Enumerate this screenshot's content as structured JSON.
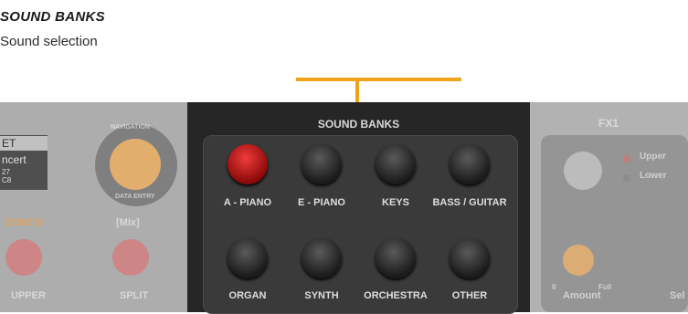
{
  "callout": {
    "title": "SOUND BANKS",
    "subtitle": "Sound selection"
  },
  "sound_banks": {
    "title": "SOUND BANKS",
    "buttons": [
      {
        "label": "A - PIANO",
        "active": true
      },
      {
        "label": "E - PIANO",
        "active": false
      },
      {
        "label": "KEYS",
        "active": false
      },
      {
        "label": "BASS / GUITAR",
        "active": false
      },
      {
        "label": "ORGAN",
        "active": false
      },
      {
        "label": "SYNTH",
        "active": false
      },
      {
        "label": "ORCHESTRA",
        "active": false
      },
      {
        "label": "OTHER",
        "active": false
      }
    ]
  },
  "left_panel": {
    "display_line1": "ET",
    "display_line2": "ncert",
    "display_small1": "27",
    "display_small2": "C8",
    "navigation_label": "NAVIGATION",
    "data_entry_label": "DATA ENTRY",
    "zone_label": "ZONE B",
    "mix_label": "[Mix]",
    "upper_label": "UPPER",
    "split_label": "SPLIT"
  },
  "right_panel": {
    "title": "FX1",
    "upper_label": "Upper",
    "lower_label": "Lower",
    "amount_label": "Amount",
    "amount_min": "0",
    "amount_max": "Full",
    "select_label": "Sel"
  },
  "colors": {
    "accent": "#f0a318",
    "active_button": "#d11a1a",
    "panel": "#262626"
  }
}
